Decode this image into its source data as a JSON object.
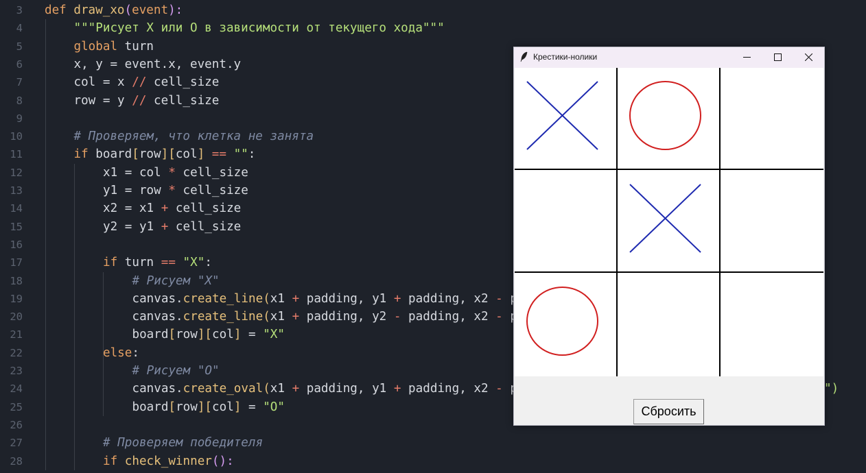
{
  "editor": {
    "lines": [
      {
        "num": "3",
        "tokens": [
          [
            "kw",
            "def "
          ],
          [
            "fn",
            "draw_xo"
          ],
          [
            "par",
            "("
          ],
          [
            "kw",
            "event"
          ],
          [
            "par",
            "):"
          ]
        ]
      },
      {
        "num": "4",
        "tokens": [
          [
            "str",
            "\"\"\"Рисует X или O в зависимости от текущего хода\"\"\""
          ]
        ]
      },
      {
        "num": "5",
        "tokens": [
          [
            "kw",
            "global "
          ],
          [
            "id",
            "turn"
          ]
        ]
      },
      {
        "num": "6",
        "tokens": [
          [
            "id",
            "x, y = event.x, event.y"
          ]
        ]
      },
      {
        "num": "7",
        "tokens": [
          [
            "id",
            "col = x "
          ],
          [
            "op",
            "//"
          ],
          [
            "id",
            " cell_size"
          ]
        ]
      },
      {
        "num": "8",
        "tokens": [
          [
            "id",
            "row = y "
          ],
          [
            "op",
            "//"
          ],
          [
            "id",
            " cell_size"
          ]
        ]
      },
      {
        "num": "9",
        "tokens": []
      },
      {
        "num": "10",
        "tokens": [
          [
            "cm",
            "# Проверяем, что клетка не занята"
          ]
        ]
      },
      {
        "num": "11",
        "tokens": [
          [
            "kw",
            "if "
          ],
          [
            "id",
            "board"
          ],
          [
            "br",
            "["
          ],
          [
            "id",
            "row"
          ],
          [
            "br",
            "]["
          ],
          [
            "id",
            "col"
          ],
          [
            "br",
            "]"
          ],
          [
            "id",
            " "
          ],
          [
            "op",
            "=="
          ],
          [
            "id",
            " "
          ],
          [
            "str",
            "\"\""
          ],
          [
            "id",
            ":"
          ]
        ]
      },
      {
        "num": "12",
        "tokens": [
          [
            "id",
            "x1 = col "
          ],
          [
            "op",
            "*"
          ],
          [
            "id",
            " cell_size"
          ]
        ]
      },
      {
        "num": "13",
        "tokens": [
          [
            "id",
            "y1 = row "
          ],
          [
            "op",
            "*"
          ],
          [
            "id",
            " cell_size"
          ]
        ]
      },
      {
        "num": "14",
        "tokens": [
          [
            "id",
            "x2 = x1 "
          ],
          [
            "op",
            "+"
          ],
          [
            "id",
            " cell_size"
          ]
        ]
      },
      {
        "num": "15",
        "tokens": [
          [
            "id",
            "y2 = y1 "
          ],
          [
            "op",
            "+"
          ],
          [
            "id",
            " cell_size"
          ]
        ]
      },
      {
        "num": "16",
        "tokens": []
      },
      {
        "num": "17",
        "tokens": [
          [
            "kw",
            "if "
          ],
          [
            "id",
            "turn "
          ],
          [
            "op",
            "=="
          ],
          [
            "id",
            " "
          ],
          [
            "str",
            "\"X\""
          ],
          [
            "id",
            ":"
          ]
        ]
      },
      {
        "num": "18",
        "tokens": [
          [
            "cm",
            "# Рисуем \"X\""
          ]
        ]
      },
      {
        "num": "19",
        "tokens": [
          [
            "id",
            "canvas."
          ],
          [
            "fn",
            "create_line"
          ],
          [
            "br",
            "("
          ],
          [
            "id",
            "x1 "
          ],
          [
            "op",
            "+"
          ],
          [
            "id",
            " padding, y1 "
          ],
          [
            "op",
            "+"
          ],
          [
            "id",
            " padding, x2 "
          ],
          [
            "op",
            "-"
          ],
          [
            "id",
            " p"
          ]
        ]
      },
      {
        "num": "20",
        "tokens": [
          [
            "id",
            "canvas."
          ],
          [
            "fn",
            "create_line"
          ],
          [
            "br",
            "("
          ],
          [
            "id",
            "x1 "
          ],
          [
            "op",
            "+"
          ],
          [
            "id",
            " padding, y2 "
          ],
          [
            "op",
            "-"
          ],
          [
            "id",
            " padding, x2 "
          ],
          [
            "op",
            "-"
          ],
          [
            "id",
            " p"
          ]
        ]
      },
      {
        "num": "21",
        "tokens": [
          [
            "id",
            "board"
          ],
          [
            "br",
            "["
          ],
          [
            "id",
            "row"
          ],
          [
            "br",
            "]["
          ],
          [
            "id",
            "col"
          ],
          [
            "br",
            "]"
          ],
          [
            "id",
            " = "
          ],
          [
            "str",
            "\"X\""
          ]
        ]
      },
      {
        "num": "22",
        "tokens": [
          [
            "kw",
            "else"
          ],
          [
            "id",
            ":"
          ]
        ]
      },
      {
        "num": "23",
        "tokens": [
          [
            "cm",
            "# Рисуем \"O\""
          ]
        ]
      },
      {
        "num": "24",
        "tokens": [
          [
            "id",
            "canvas."
          ],
          [
            "fn",
            "create_oval"
          ],
          [
            "br",
            "("
          ],
          [
            "id",
            "x1 "
          ],
          [
            "op",
            "+"
          ],
          [
            "id",
            " padding, y1 "
          ],
          [
            "op",
            "+"
          ],
          [
            "id",
            " padding, x2 "
          ],
          [
            "op",
            "-"
          ],
          [
            "id",
            " p"
          ]
        ]
      },
      {
        "num": "25",
        "tokens": [
          [
            "id",
            "board"
          ],
          [
            "br",
            "["
          ],
          [
            "id",
            "row"
          ],
          [
            "br",
            "]["
          ],
          [
            "id",
            "col"
          ],
          [
            "br",
            "]"
          ],
          [
            "id",
            " = "
          ],
          [
            "str",
            "\"O\""
          ]
        ]
      },
      {
        "num": "26",
        "tokens": []
      },
      {
        "num": "27",
        "tokens": [
          [
            "cm",
            "# Проверяем победителя"
          ]
        ]
      },
      {
        "num": "28",
        "tokens": [
          [
            "kw",
            "if "
          ],
          [
            "fn",
            "check_winner"
          ],
          [
            "par",
            "():"
          ]
        ]
      }
    ],
    "overflow_fragment_24": "\")"
  },
  "window": {
    "title": "Крестики-нолики",
    "icon": "feather-icon",
    "controls": [
      "minimize-icon",
      "maximize-icon",
      "close-icon"
    ],
    "reset_label": "Сбросить",
    "x_color": "#1e2ab0",
    "o_color": "#d11f1f",
    "grid_color": "#000000",
    "board": [
      [
        "X",
        "O",
        ""
      ],
      [
        "",
        "X",
        ""
      ],
      [
        "O",
        "",
        ""
      ]
    ]
  }
}
